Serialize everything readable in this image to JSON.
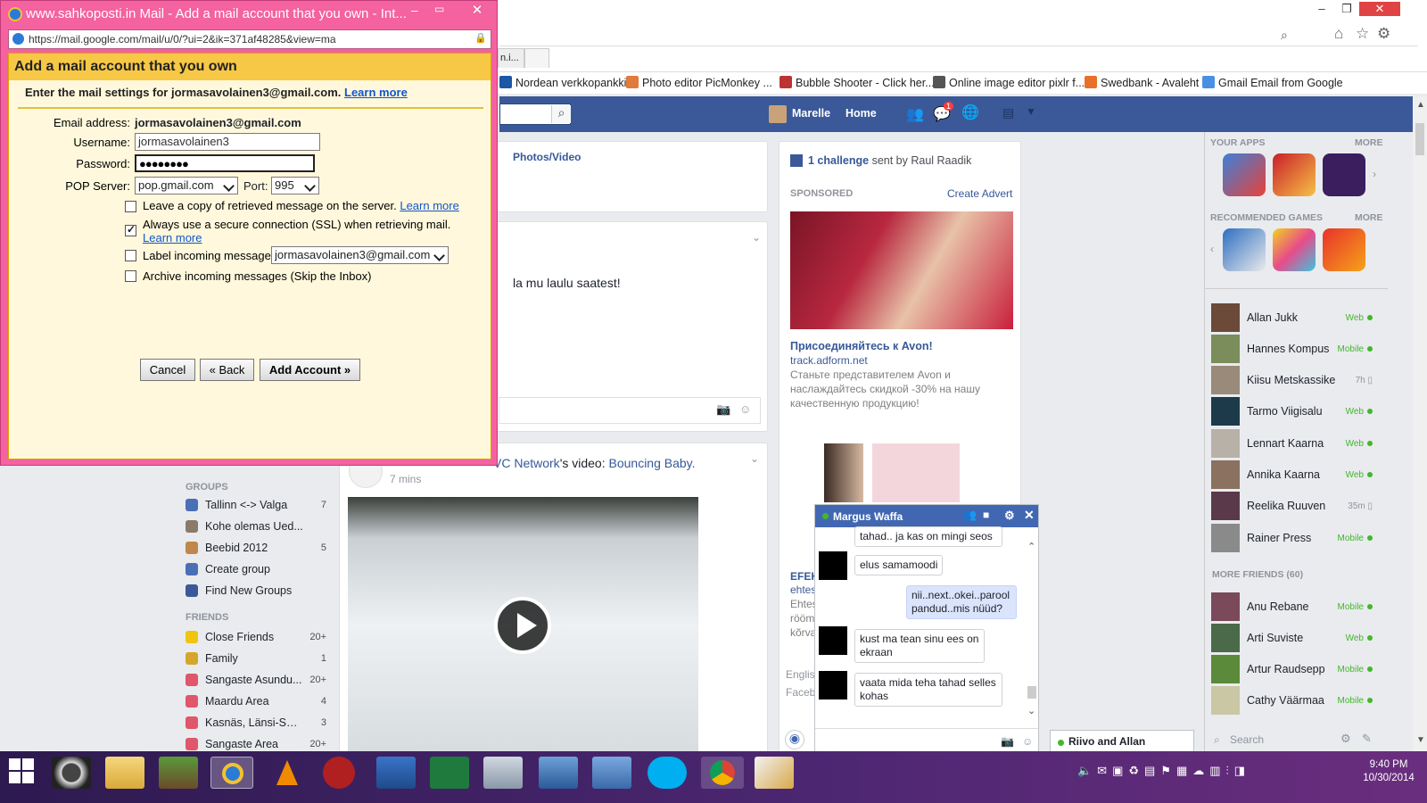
{
  "popup": {
    "title": "www.sahkoposti.in Mail - Add a mail account that you own - Int...",
    "url": "https://mail.google.com/mail/u/0/?ui=2&ik=371af48285&view=ma",
    "heading": "Add a mail account that you own",
    "intro": "Enter the mail settings for jormasavolainen3@gmail.com.",
    "learn_more": "Learn more",
    "email_label": "Email address:",
    "email_value": "jormasavolainen3@gmail.com",
    "username_label": "Username:",
    "username_value": "jormasavolainen3",
    "password_label": "Password:",
    "password_value": "●●●●●●●●",
    "pop_label": "POP Server:",
    "pop_value": "pop.gmail.com",
    "port_label": "Port:",
    "port_value": "995",
    "opt_leave_copy": "Leave a copy of retrieved message on the server.",
    "opt_ssl": "Always use a secure connection (SSL) when retrieving mail.",
    "opt_label": "Label incoming messages:",
    "opt_label_value": "jormasavolainen3@gmail.com",
    "opt_archive": "Archive incoming messages (Skip the Inbox)",
    "cancel": "Cancel",
    "back": "« Back",
    "add": "Add Account »",
    "ssl_checked": true
  },
  "browser": {
    "tab_partial": "n.i...",
    "bookmarks": [
      {
        "label": "Nordean verkkopankki",
        "color": "#1a57a6"
      },
      {
        "label": "Photo editor  PicMonkey ...",
        "color": "#e07b3a"
      },
      {
        "label": "Bubble Shooter - Click her...",
        "color": "#b33"
      },
      {
        "label": "Online image editor pixlr f...",
        "color": "#555"
      },
      {
        "label": "Swedbank - Avaleht",
        "color": "#e8702a"
      },
      {
        "label": "Gmail Email from Google",
        "color": "#4a90e2"
      }
    ]
  },
  "facebook": {
    "user": "Marelle",
    "home": "Home",
    "notif_count": "1",
    "photos_video": "Photos/Video",
    "post_text": "la mu laulu saatest!",
    "video_meta_prefix": "VC Network",
    "video_meta_mid": "'s video: ",
    "video_meta_link": "Bouncing Baby.",
    "video_time": "7 mins",
    "challenge_count": "1 challenge",
    "challenge_rest": " sent by Raul Raadik",
    "sponsored": "SPONSORED",
    "create_advert": "Create Advert",
    "ad_title": "Присоединяйтесь к Avon!",
    "ad_domain": "track.adform.net",
    "ad_text": "Станьте представителем Avon и наслаждайтесь скидкой -30% на нашу качественную продукцию!",
    "ad2_title": "EFEK",
    "ad2_domain": "ehtes",
    "ad2_text1": "Ehtes",
    "ad2_text2": "rööm",
    "ad2_text3": "kõrva",
    "footer_lang": "Englis",
    "footer_fb": "Faceb",
    "groups_header": "GROUPS",
    "groups": [
      {
        "label": "Tallinn <-> Valga",
        "count": "7",
        "color": "#4a6fb5"
      },
      {
        "label": "Kohe olemas Ued...",
        "count": "",
        "color": "#8b7a6a"
      },
      {
        "label": "Beebid 2012",
        "count": "5",
        "color": "#c0864a"
      },
      {
        "label": "Create group",
        "count": "",
        "color": "#4a6fb5"
      },
      {
        "label": "Find New Groups",
        "count": "",
        "color": "#3b5998"
      }
    ],
    "friends_header": "FRIENDS",
    "friends_lists": [
      {
        "label": "Close Friends",
        "count": "20+",
        "color": "#f1c40f"
      },
      {
        "label": "Family",
        "count": "1",
        "color": "#d4a72c"
      },
      {
        "label": "Sangaste Asundu...",
        "count": "20+",
        "color": "#e0566b"
      },
      {
        "label": "Maardu Area",
        "count": "4",
        "color": "#e0566b"
      },
      {
        "label": "Kasnäs, Länsi-Suo...",
        "count": "3",
        "color": "#e0566b"
      },
      {
        "label": "Sangaste Area",
        "count": "20+",
        "color": "#e0566b"
      }
    ]
  },
  "sidebar": {
    "your_apps": "YOUR APPS",
    "more": "MORE",
    "recommended": "RECOMMENDED GAMES",
    "more2": "MORE",
    "more_friends": "MORE FRIENDS (60)",
    "search": "Search",
    "online": [
      {
        "name": "Allan Jukk",
        "status": "Web",
        "color": "#6b4a3a"
      },
      {
        "name": "Hannes Kompus",
        "status": "Mobile",
        "color": "#7a8d5a"
      },
      {
        "name": "Kiisu Metskassike",
        "status": "7h",
        "color": "#9a8a7a"
      },
      {
        "name": "Tarmo Viigisalu",
        "status": "Web",
        "color": "#1c3a4a"
      },
      {
        "name": "Lennart Kaarna",
        "status": "Web",
        "color": "#b7b1a8"
      },
      {
        "name": "Annika Kaarna",
        "status": "Web",
        "color": "#8a7160"
      },
      {
        "name": "Reelika Ruuven",
        "status": "35m",
        "color": "#5a3a4a"
      },
      {
        "name": "Rainer Press",
        "status": "Mobile",
        "color": "#8a8a8a"
      }
    ],
    "more_list": [
      {
        "name": "Anu Rebane",
        "status": "Mobile",
        "color": "#7a4a5a"
      },
      {
        "name": "Arti Suviste",
        "status": "Web",
        "color": "#4a6a4a"
      },
      {
        "name": "Artur Raudsepp",
        "status": "Mobile",
        "color": "#5a8a3a"
      },
      {
        "name": "Cathy Väärmaa",
        "status": "Mobile",
        "color": "#c9c7a4"
      }
    ]
  },
  "chat": {
    "name": "Margus Waffa",
    "messages": [
      {
        "text": "tahad.. ja kas on mingi seos",
        "me": false
      },
      {
        "text": "elus samamoodi",
        "me": false
      },
      {
        "text": "nii..next..okei..parool pandud..mis nüüd?",
        "me": true
      },
      {
        "text": "kust ma tean sinu ees on ekraan",
        "me": false
      },
      {
        "text": "vaata mida teha tahad selles kohas",
        "me": false
      }
    ],
    "tab2": "Riivo and Allan"
  },
  "taskbar": {
    "time": "9:40 PM",
    "date": "10/30/2014"
  }
}
